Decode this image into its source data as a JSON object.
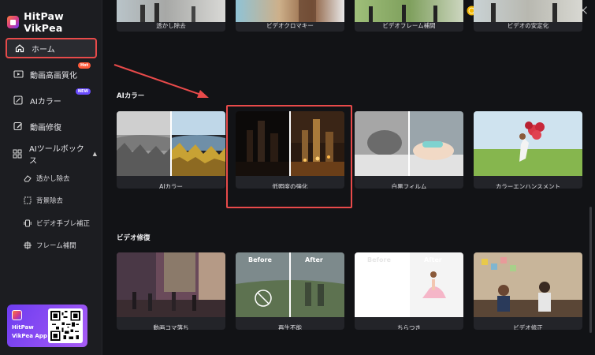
{
  "app": {
    "name": "HitPaw VikPea"
  },
  "sidebar": {
    "home": "ホーム",
    "enhance": "動画高画質化",
    "enhance_badge": "Hot",
    "colorize": "AIカラー",
    "colorize_badge": "NEW",
    "repair": "動画修復",
    "ai_tools": "AIツールボックス",
    "sub": [
      "透かし除去",
      "背景除去",
      "ビデオ手ブレ補正",
      "フレーム補間"
    ]
  },
  "promo": {
    "line1": "HitPaw",
    "line2": "VikPea App"
  },
  "top_row": [
    "透かし除去",
    "ビデオクロマキー",
    "ビデオフレーム補間",
    "ビデオの安定化"
  ],
  "sections": {
    "ai_color": "AIカラー",
    "video_repair": "ビデオ修復"
  },
  "ai_row": [
    "AIカラー",
    "低照度の強化",
    "白黒フィルム",
    "カラーエンハンスメント"
  ],
  "repair_row": [
    "動画コマ落ち",
    "再生不能",
    "ちらつき",
    "ビデオ修正"
  ],
  "before_after": {
    "before": "Before",
    "after": "After"
  },
  "colors": {
    "accent": "#e84a4a",
    "sidebar": "#1c1d21",
    "content": "#121316",
    "promo": "#8a4cf5"
  },
  "icons": [
    "discord-icon",
    "coin-icon",
    "user-icon",
    "menu-icon",
    "minimize-icon",
    "maximize-icon",
    "close-icon"
  ]
}
